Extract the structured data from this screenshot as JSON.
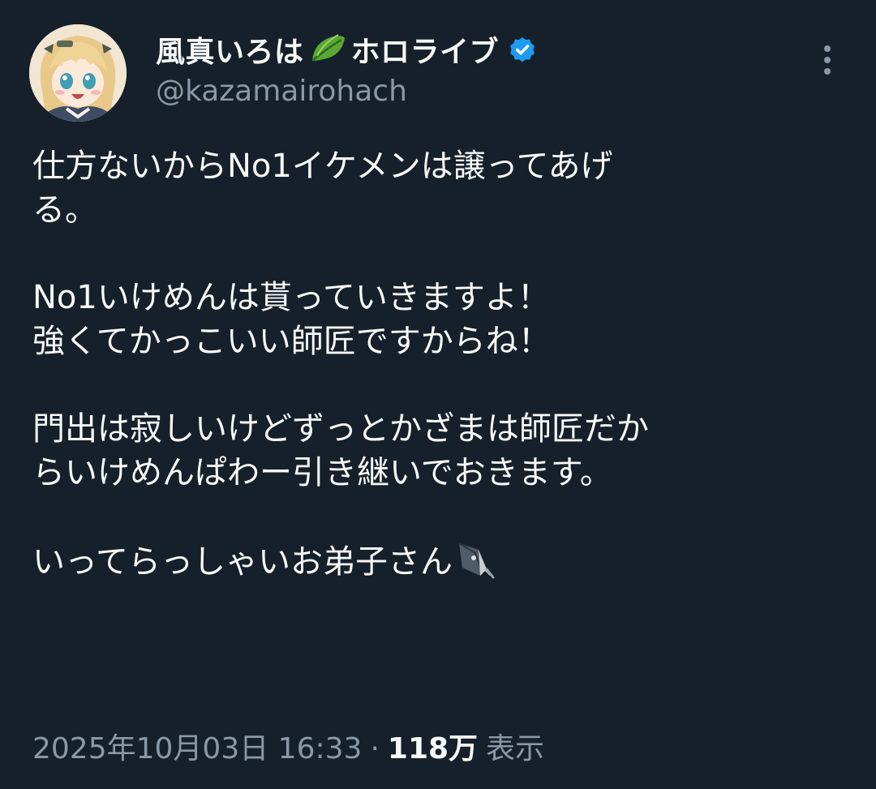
{
  "author": {
    "display_name": "風真いろは",
    "display_suffix": "ホロライブ",
    "handle": "@kazamairohach"
  },
  "icons": {
    "name_emoji": "leaf-icon",
    "verified": "verified-badge-icon",
    "more": "more-vertical-icon",
    "text_emoji": "fountain-pen-icon"
  },
  "tweet": {
    "paragraphs": [
      "仕方ないからNo1イケメンは譲ってあげ\nる。",
      "No1いけめんは貰っていきますよ！\n強くてかっこいい師匠ですからね！",
      "門出は寂しいけどずっとかざまは師匠だか\nらいけめんぱわー引き継いでおきます。",
      "いってらっしゃいお弟子さん"
    ]
  },
  "meta": {
    "timestamp": "2025年10月03日 16:33",
    "separator": "·",
    "views_count": "118万",
    "views_label": "表示"
  },
  "colors": {
    "background": "#15202b",
    "text_primary": "#f7f9f9",
    "text_secondary": "#8b98a5",
    "verified_blue": "#1d9bf0"
  }
}
